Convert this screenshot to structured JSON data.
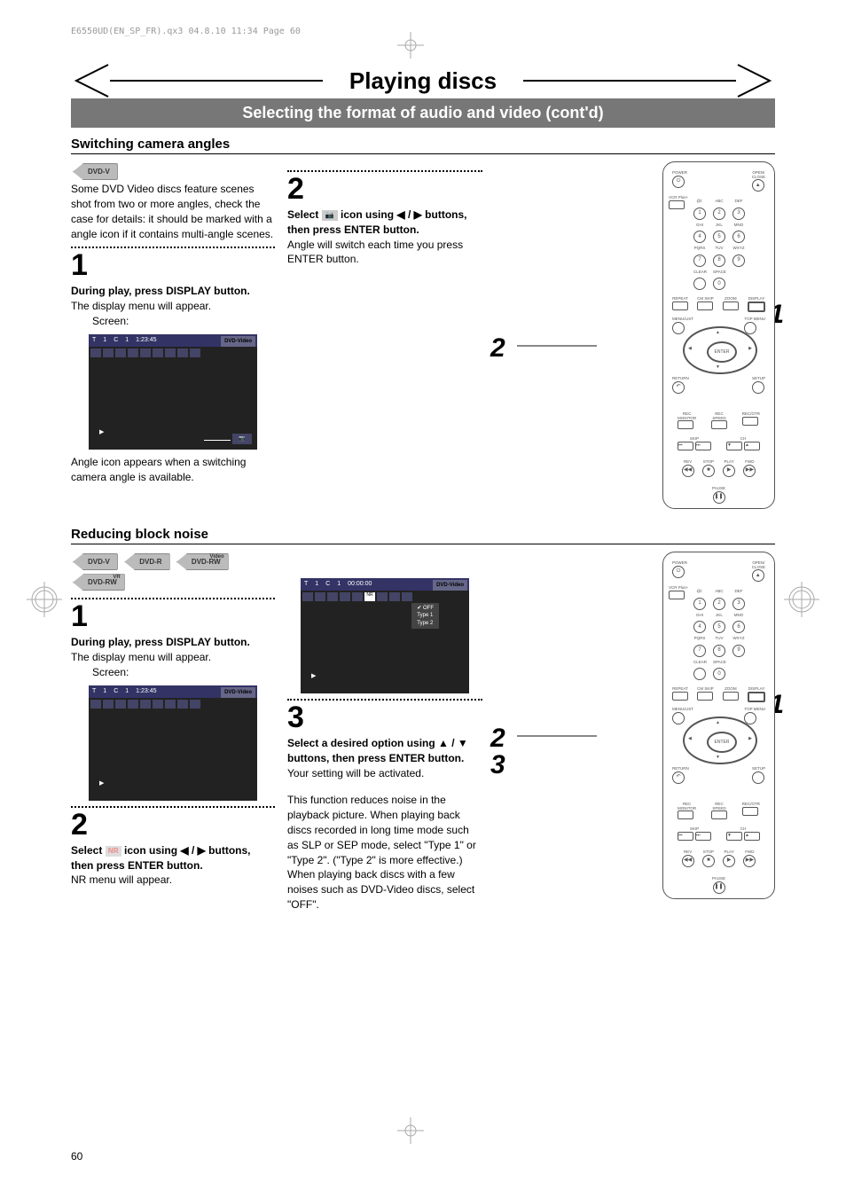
{
  "print_header": "E6550UD(EN_SP_FR).qx3  04.8.10  11:34  Page 60",
  "chapter_title": "Playing discs",
  "subtitle": "Selecting the format of audio and video (cont'd)",
  "page_number": "60",
  "section1": {
    "heading": "Switching camera angles",
    "disc_badges": [
      "DVD-V"
    ],
    "intro": "Some DVD Video discs feature scenes shot from two or more angles, check the case for details: it should be marked with a angle icon if it contains multi-angle scenes.",
    "step1": {
      "num": "1",
      "bold": "During play, press DISPLAY button.",
      "body": "The display menu will appear.",
      "screen_label": "Screen:",
      "screen": {
        "info": [
          "T",
          "1",
          "C",
          "1",
          "1:23:45"
        ],
        "badge": "DVD-Video",
        "note": "Angle icon appears when a switching camera angle is available."
      }
    },
    "step2": {
      "num": "2",
      "bold_pre": "Select ",
      "bold_icon": "camera-icon",
      "bold_post": " icon using ◀ / ▶ buttons, then press ENTER button.",
      "body": "Angle will switch each time you press ENTER button."
    }
  },
  "section2": {
    "heading": "Reducing block noise",
    "disc_badges": [
      "DVD-V",
      "DVD-R",
      "DVD-RW Video",
      "DVD-RW VR"
    ],
    "step1": {
      "num": "1",
      "bold": "During play, press DISPLAY button.",
      "body": "The display menu will appear.",
      "screen_label": "Screen:",
      "screen": {
        "info": [
          "T",
          "1",
          "C",
          "1",
          "1:23:45"
        ],
        "badge": "DVD-Video"
      }
    },
    "step2": {
      "num": "2",
      "bold_pre": "Select ",
      "bold_icon": "nr-icon",
      "bold_post": " icon using ◀ / ▶ buttons, then press ENTER button.",
      "body": "NR menu will appear.",
      "screen": {
        "info": [
          "T",
          "1",
          "C",
          "1",
          "00:00:00"
        ],
        "badge": "DVD-Video",
        "menu": {
          "selected": "OFF",
          "opt1": "Type 1",
          "opt2": "Type 2"
        }
      }
    },
    "step3": {
      "num": "3",
      "bold": "Select a desired option using ▲ / ▼ buttons, then press ENTER button.",
      "body": "Your setting will be activated.",
      "extra": "This function reduces noise in the playback picture. When playing back discs recorded in long time mode such as SLP or SEP mode, select \"Type 1\" or \"Type 2\". (\"Type 2\" is more effective.) When playing back discs with a few noises such as DVD-Video discs, select \"OFF\"."
    }
  },
  "remote": {
    "power": "POWER",
    "open_close": "OPEN/\nCLOSE",
    "vcr_plus": "VCR Plus+",
    "digits": [
      "1",
      "2",
      "3",
      "4",
      "5",
      "6",
      "7",
      "8",
      "9",
      "0"
    ],
    "digit_labels": [
      "@!:",
      "ABC",
      "DEF",
      "GHI",
      "JKL",
      "MNO",
      "PQRS",
      "TUV",
      "WXYZ"
    ],
    "clear": "CLEAR",
    "space": "SPACE",
    "repeat": "REPEAT",
    "cmskip": "CM SKIP",
    "zoom": "ZOOM",
    "display": "DISPLAY",
    "menulist": "MENU/LIST",
    "topmenu": "TOP MENU",
    "enter": "ENTER",
    "return": "RETURN",
    "setup": "SETUP",
    "rec_monitor": "REC\nMONITOR",
    "rec_speed": "REC\nSPEED",
    "rec_otr": "REC/OTR",
    "skip": "SKIP",
    "ch": "CH",
    "stop": "STOP",
    "play": "PLAY",
    "rev": "REV",
    "fwd": "FWD",
    "pause": "PAUSE"
  },
  "callouts1": {
    "n1": "1",
    "n2": "2"
  },
  "callouts2": {
    "n1": "1",
    "n2": "2",
    "n3": "3"
  }
}
